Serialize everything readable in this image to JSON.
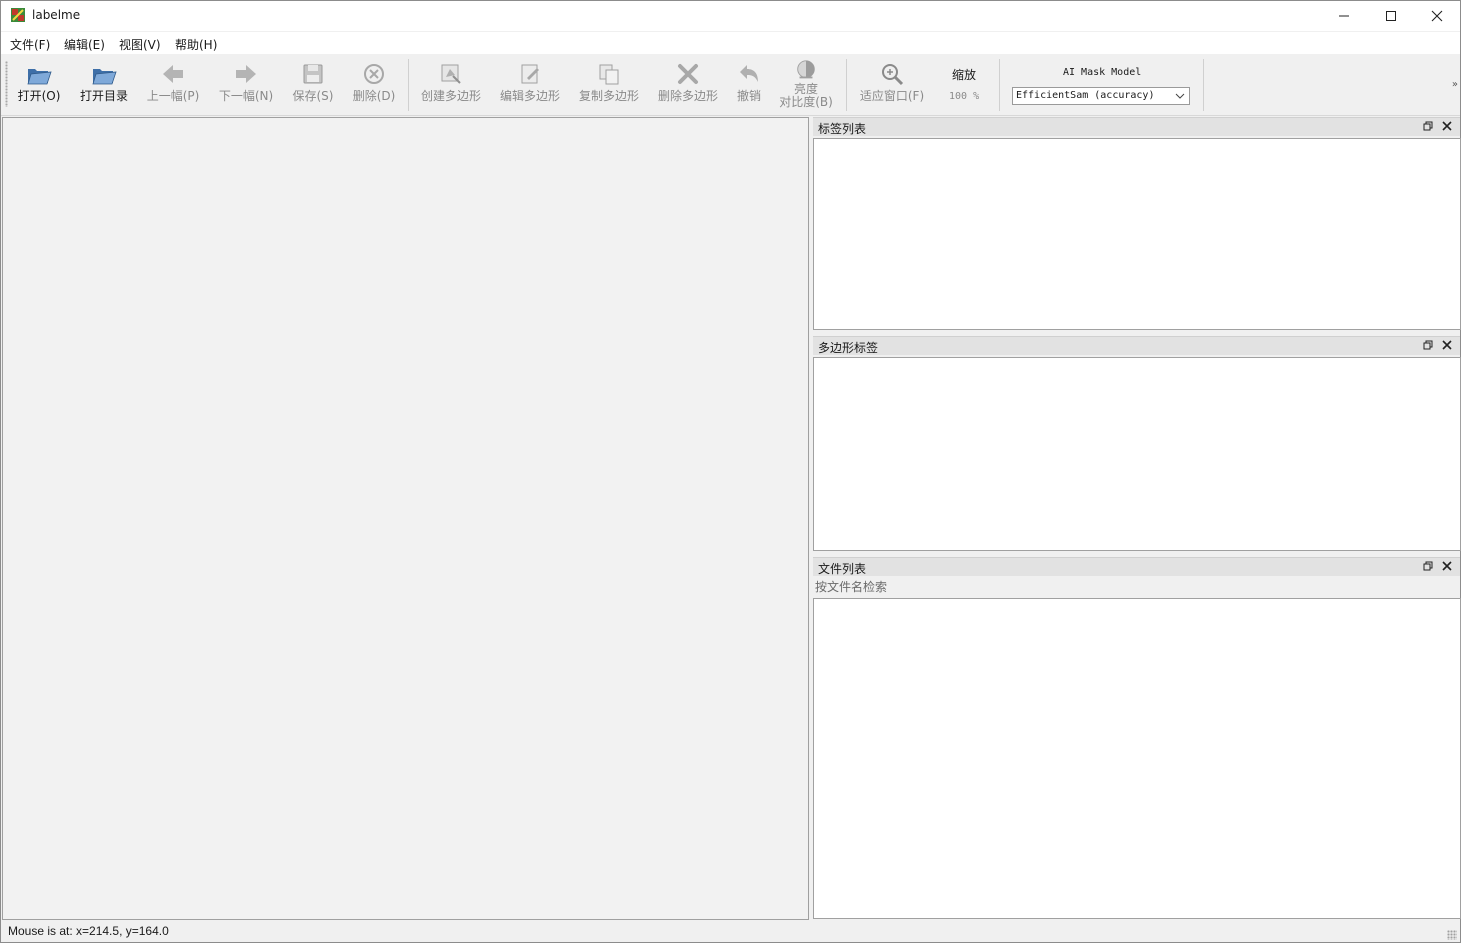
{
  "window": {
    "title": "labelme",
    "controls": {
      "minimize": "minimize",
      "maximize": "maximize",
      "close": "close"
    }
  },
  "menu": {
    "items": [
      {
        "label": "文件(F)"
      },
      {
        "label": "编辑(E)"
      },
      {
        "label": "视图(V)"
      },
      {
        "label": "帮助(H)"
      }
    ]
  },
  "toolbar": {
    "open": "打开(O)",
    "open_dir": "打开目录",
    "prev": "上一幅(P)",
    "next": "下一幅(N)",
    "save": "保存(S)",
    "delete": "删除(D)",
    "create_polygon": "创建多边形",
    "edit_polygon": "编辑多边形",
    "copy_polygon": "复制多边形",
    "delete_polygon": "删除多边形",
    "undo": "撤销",
    "brightness_line1": "亮度",
    "brightness_line2": "对比度(B)",
    "fit_window": "适应窗口(F)",
    "zoom_label": "缩放",
    "zoom_value": "100 %",
    "ai_model_label": "AI Mask Model",
    "ai_model_selected": "EfficientSam (accuracy)",
    "extension": "»"
  },
  "docks": {
    "label_list": {
      "title": "标签列表"
    },
    "polygon_labels": {
      "title": "多边形标签"
    },
    "file_list": {
      "title": "文件列表",
      "search_placeholder": "按文件名检索"
    }
  },
  "status": {
    "text": "Mouse is at: x=214.5, y=164.0"
  },
  "colors": {
    "background": "#f0f0f0",
    "dock_title": "#e2e2e2",
    "disabled_text": "#8a8a8a",
    "open_icon": "#4f81bd"
  }
}
